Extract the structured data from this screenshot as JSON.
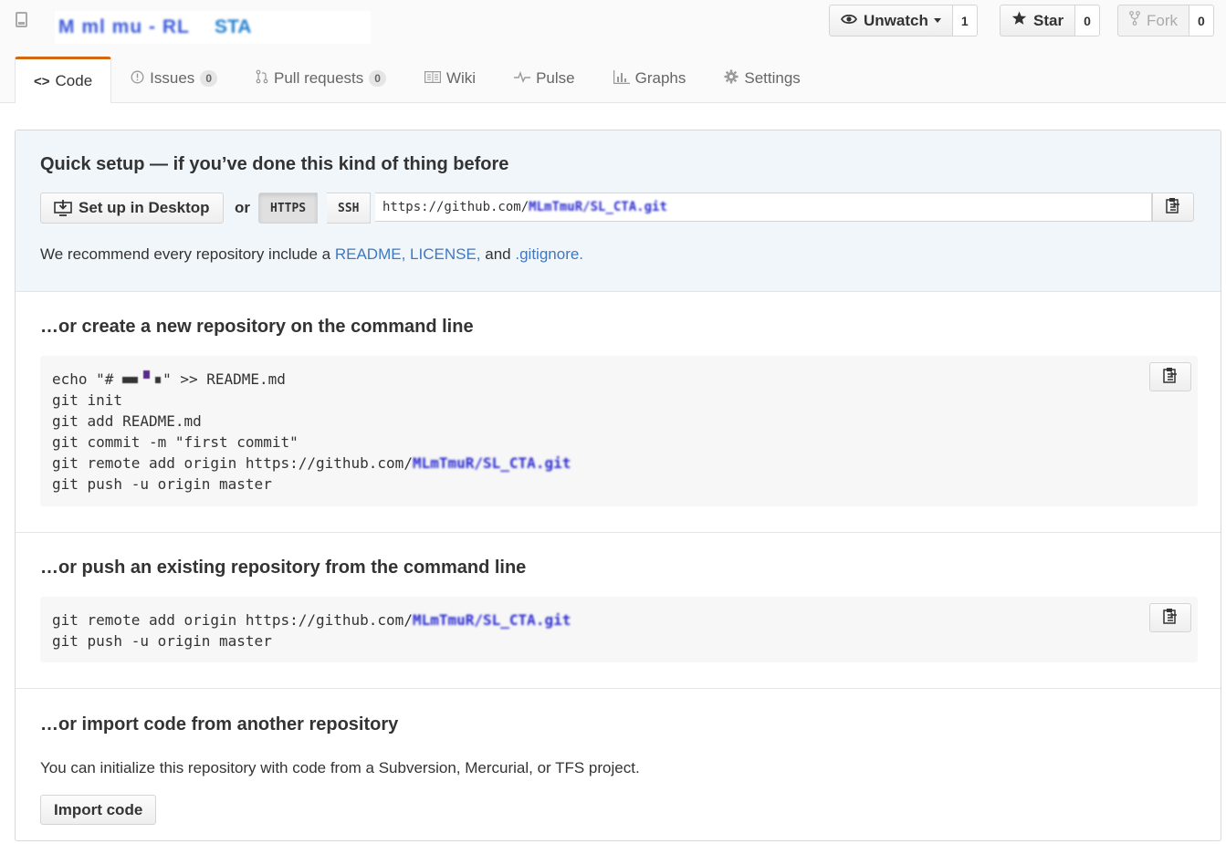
{
  "repo": {
    "name_part1": "M ml mu - RL",
    "name_part2": "STA"
  },
  "actions": {
    "watch": {
      "label": "Unwatch",
      "count": "1"
    },
    "star": {
      "label": "Star",
      "count": "0"
    },
    "fork": {
      "label": "Fork",
      "count": "0"
    }
  },
  "tabs": [
    {
      "label": "Code",
      "counter": null
    },
    {
      "label": "Issues",
      "counter": "0"
    },
    {
      "label": "Pull requests",
      "counter": "0"
    },
    {
      "label": "Wiki",
      "counter": null
    },
    {
      "label": "Pulse",
      "counter": null
    },
    {
      "label": "Graphs",
      "counter": null
    },
    {
      "label": "Settings",
      "counter": null
    }
  ],
  "quick_setup": {
    "title": "Quick setup — if you’ve done this kind of thing before",
    "desktop_button": "Set up in Desktop",
    "or": "or",
    "https": "HTTPS",
    "ssh": "SSH",
    "url_prefix": "https://github.com/",
    "url_blurred": "MLmTmuR/SL_CTA.git",
    "recommend_prefix": "We recommend every repository include a",
    "readme": "README,",
    "license": "LICENSE,",
    "and": "and",
    "gitignore": ".gitignore."
  },
  "new_repo": {
    "title": "…or create a new repository on the command line",
    "line1_prefix": "echo \"# ",
    "line1_suffix": "\" >> README.md",
    "line2": "git init",
    "line3": "git add README.md",
    "line4": "git commit -m \"first commit\"",
    "line5_prefix": "git remote add origin https://github.com/",
    "line5_blurred": "MLmTmuR/SL_CTA.git",
    "line6": "git push -u origin master"
  },
  "push_repo": {
    "title": "…or push an existing repository from the command line",
    "line1_prefix": "git remote add origin https://github.com/",
    "line1_blurred": "MLmTmuR/SL_CTA.git",
    "line2": "git push -u origin master"
  },
  "import_repo": {
    "title": "…or import code from another repository",
    "text": "You can initialize this repository with code from a Subversion, Mercurial, or TFS project.",
    "button": "Import code"
  },
  "colors": {
    "accent_tab": "#d26911",
    "link": "#4078c0",
    "setup_bg": "#f1f6fb"
  }
}
